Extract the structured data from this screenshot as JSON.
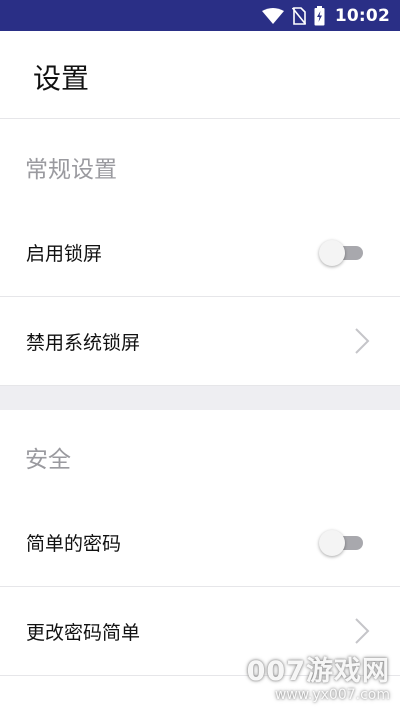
{
  "status_bar": {
    "time": "10:02",
    "icons": [
      "wifi-icon",
      "no-sim-icon",
      "battery-charging-icon"
    ],
    "background": "#2a2f86"
  },
  "header": {
    "title": "设置"
  },
  "sections": [
    {
      "title": "常规设置",
      "rows": [
        {
          "label": "启用锁屏",
          "control": "toggle",
          "state": "off"
        },
        {
          "label": "禁用系统锁屏",
          "control": "chevron-right-icon"
        }
      ]
    },
    {
      "title": "安全",
      "rows": [
        {
          "label": "简单的密码",
          "control": "toggle",
          "state": "off"
        },
        {
          "label": "更改密码简单",
          "control": "chevron-right-icon"
        }
      ]
    }
  ],
  "watermark": {
    "main": "007游戏网",
    "url": "www.yx007.com"
  }
}
